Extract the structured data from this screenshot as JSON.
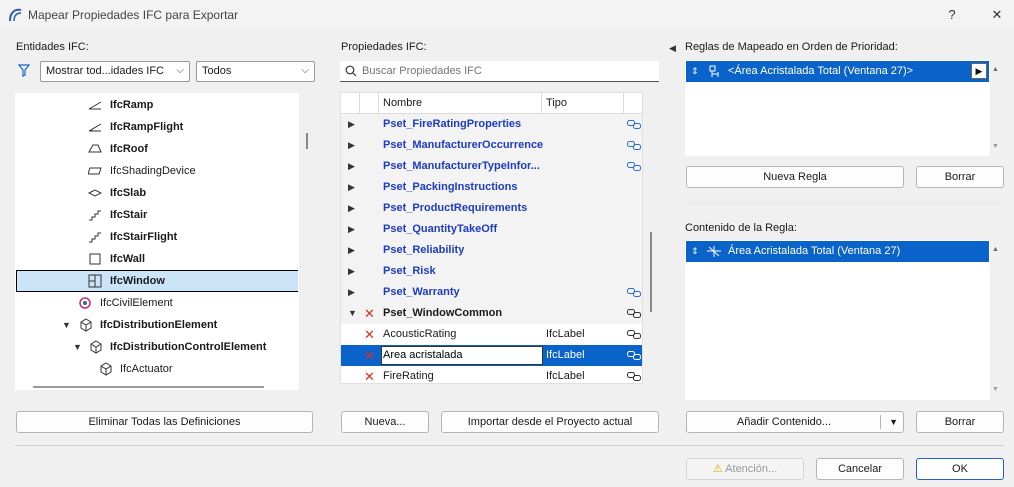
{
  "window": {
    "title": "Mapear Propiedades IFC para Exportar",
    "help": "?",
    "close": "✕"
  },
  "left": {
    "label": "Entidades IFC:",
    "filter1": "Mostrar tod...idades IFC",
    "filter2": "Todos",
    "tree": [
      {
        "label": "IfcRamp",
        "bold": true
      },
      {
        "label": "IfcRampFlight",
        "bold": true
      },
      {
        "label": "IfcRoof",
        "bold": true
      },
      {
        "label": "IfcShadingDevice",
        "bold": false
      },
      {
        "label": "IfcSlab",
        "bold": true
      },
      {
        "label": "IfcStair",
        "bold": true
      },
      {
        "label": "IfcStairFlight",
        "bold": true
      },
      {
        "label": "IfcWall",
        "bold": true
      },
      {
        "label": "IfcWindow",
        "bold": true
      },
      {
        "label": "IfcCivilElement",
        "bold": false
      },
      {
        "label": "IfcDistributionElement",
        "bold": true
      },
      {
        "label": "IfcDistributionControlElement",
        "bold": true
      },
      {
        "label": "IfcActuator",
        "bold": false
      }
    ],
    "delete_all": "Eliminar Todas las Definiciones"
  },
  "middle": {
    "label": "Propiedades IFC:",
    "search_placeholder": "Buscar Propiedades IFC",
    "col_name": "Nombre",
    "col_type": "Tipo",
    "rows": [
      {
        "name": "Pset_FireRatingProperties",
        "type": ""
      },
      {
        "name": "Pset_ManufacturerOccurrence",
        "type": ""
      },
      {
        "name": "Pset_ManufacturerTypeInfor...",
        "type": ""
      },
      {
        "name": "Pset_PackingInstructions",
        "type": ""
      },
      {
        "name": "Pset_ProductRequirements",
        "type": ""
      },
      {
        "name": "Pset_QuantityTakeOff",
        "type": ""
      },
      {
        "name": "Pset_Reliability",
        "type": ""
      },
      {
        "name": "Pset_Risk",
        "type": ""
      },
      {
        "name": "Pset_Warranty",
        "type": ""
      },
      {
        "name": "Pset_WindowCommon",
        "type": ""
      },
      {
        "name": "AcousticRating",
        "type": "IfcLabel"
      },
      {
        "name": "Area acristalada",
        "type": "IfcLabel"
      },
      {
        "name": "FireRating",
        "type": "IfcLabel"
      }
    ],
    "new_btn": "Nueva...",
    "import_btn": "Importar desde el Proyecto actual"
  },
  "right": {
    "rules_label": "Reglas de Mapeado en Orden de Prioridad:",
    "rule_item": "<Área Acristalada Total (Ventana 27)>",
    "new_rule": "Nueva Regla",
    "delete_rule": "Borrar",
    "content_label": "Contenido de la Regla:",
    "content_item": "Área Acristalada Total (Ventana 27)",
    "add_content": "Añadir Contenido...",
    "delete_content": "Borrar"
  },
  "footer": {
    "warning": "Atención...",
    "cancel": "Cancelar",
    "ok": "OK"
  },
  "colors": {
    "selection_blue": "#0a63c8",
    "pset_blue": "#1d3cc2",
    "tree_selected": "#cce4f7",
    "delete_red": "#d83020"
  }
}
